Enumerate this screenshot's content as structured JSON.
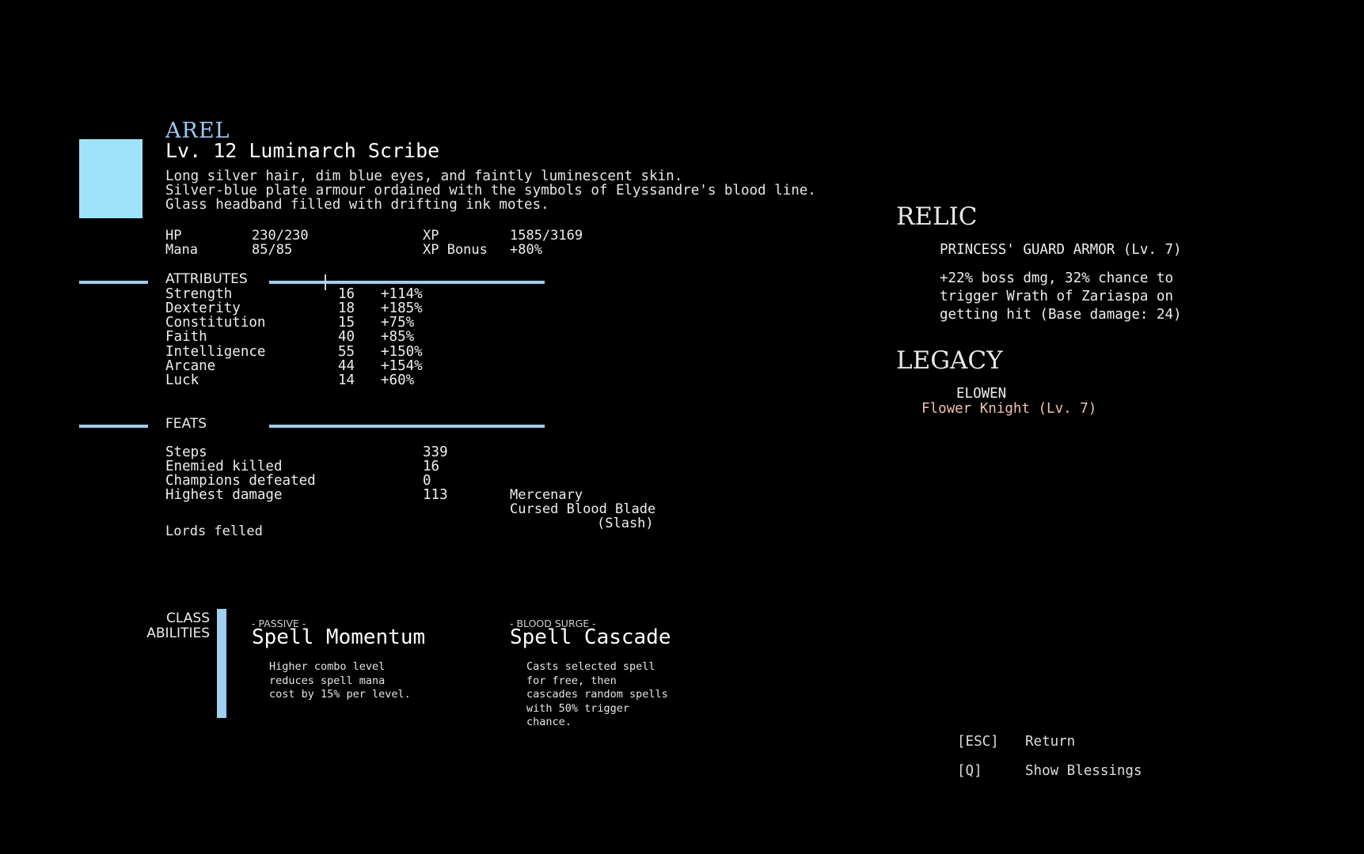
{
  "character": {
    "name": "AREL",
    "title": "Lv. 12 Luminarch Scribe",
    "description": [
      "Long silver hair, dim blue eyes, and faintly luminescent skin.",
      "Silver-blue plate armour ordained with the symbols of Elyssandre's blood line.",
      "Glass headband filled with drifting ink motes."
    ],
    "portrait_color": "#9fe3f8"
  },
  "stats": {
    "hp_label": "HP",
    "hp_value": "230/230",
    "mana_label": "Mana",
    "mana_value": "85/85",
    "xp_label": "XP",
    "xp_value": "1585/3169",
    "xp_bonus_label": "XP Bonus",
    "xp_bonus_value": "+80%"
  },
  "attributes": {
    "label": "ATTRIBUTES",
    "rows": [
      {
        "name": "Strength",
        "value": "16",
        "bonus": "+114%"
      },
      {
        "name": "Dexterity",
        "value": "18",
        "bonus": "+185%"
      },
      {
        "name": "Constitution",
        "value": "15",
        "bonus": "+75%"
      },
      {
        "name": "Faith",
        "value": "40",
        "bonus": "+85%"
      },
      {
        "name": "Intelligence",
        "value": "55",
        "bonus": "+150%"
      },
      {
        "name": "Arcane",
        "value": "44",
        "bonus": "+154%"
      },
      {
        "name": "Luck",
        "value": "14",
        "bonus": "+60%"
      }
    ]
  },
  "feats": {
    "label": "FEATS",
    "rows": [
      {
        "name": "Steps",
        "value": "339"
      },
      {
        "name": "Enemied killed",
        "value": "16"
      },
      {
        "name": "Champions defeated",
        "value": "0"
      },
      {
        "name": "Highest damage",
        "value": "113"
      }
    ],
    "highest_damage_source": [
      "Mercenary",
      "Cursed Blood Blade",
      "(Slash)"
    ],
    "lords_felled_label": "Lords felled"
  },
  "abilities": {
    "label": [
      "CLASS",
      "ABILITIES"
    ],
    "items": [
      {
        "tag": "- PASSIVE -",
        "name": "Spell Momentum",
        "desc": [
          "Higher combo level",
          "reduces spell mana",
          "cost by 15% per level."
        ]
      },
      {
        "tag": "- BLOOD SURGE -",
        "name": "Spell Cascade",
        "desc": [
          "Casts selected spell",
          "for free, then",
          "cascades random spells",
          "with 50% trigger",
          "chance."
        ]
      }
    ]
  },
  "relic": {
    "heading": "RELIC",
    "item": "PRINCESS' GUARD ARMOR (Lv. 7)",
    "effect": [
      "+22% boss dmg, 32% chance to",
      "trigger Wrath of Zariaspa on",
      "getting hit (Base damage: 24)"
    ]
  },
  "legacy": {
    "heading": "LEGACY",
    "name": "ELOWEN",
    "class": "Flower Knight (Lv. 7)"
  },
  "controls": [
    {
      "key": "[ESC]",
      "action": "Return"
    },
    {
      "key": "[Q]",
      "action": "Show Blessings"
    }
  ],
  "colors": {
    "accent": "#9fcdee",
    "name": "#9fc7f2",
    "legacy_class": "#f0c3b0",
    "background": "#000000"
  }
}
